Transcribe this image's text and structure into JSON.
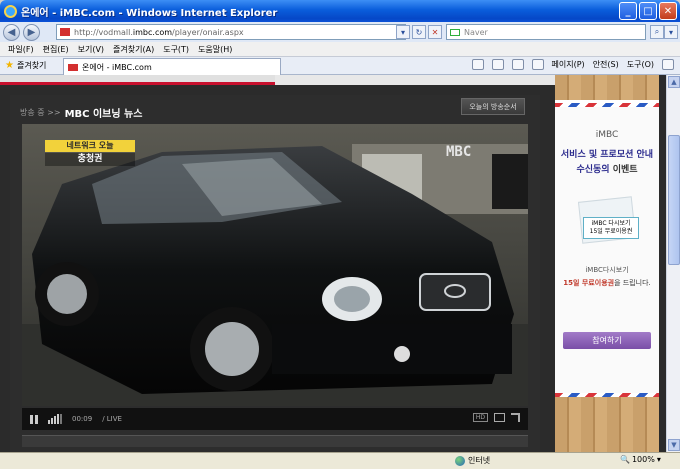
{
  "window": {
    "title": "온에어 - iMBC.com - Windows Internet Explorer"
  },
  "address": {
    "url_prefix": "http://vodmall.",
    "url_domain": "imbc.com",
    "url_suffix": "/player/onair.aspx",
    "search_placeholder": "Naver"
  },
  "menu": [
    "파일(F)",
    "편집(E)",
    "보기(V)",
    "즐겨찾기(A)",
    "도구(T)",
    "도움말(H)"
  ],
  "favbar": {
    "favorites_label": "즐겨찾기",
    "tab_title": "온에어 - iMBC.com",
    "tools": [
      "페이지(P)",
      "안전(S)",
      "도구(O)"
    ]
  },
  "player": {
    "breadcrumb_section": "방송 중 >>",
    "program_title": "MBC 이브닝 뉴스",
    "schedule_button": "오늘의 방송순서",
    "overlay_tag": "네트워크 오늘",
    "overlay_region": "충청권",
    "channel_logo": "MBC",
    "time": "00:09",
    "live_label": "/ LIVE",
    "hd_label": "HD"
  },
  "ad": {
    "brand": "iMBC",
    "headline1": "서비스 및 프로모션 안내",
    "headline2_highlight": "수신동의",
    "headline2_rest": " 이벤트",
    "coupon_line1": "iMBC 다시보기",
    "coupon_line2": "15일 무료이용권",
    "desc1": "iMBC다시보기",
    "desc2_highlight": "15일 무료이용권",
    "desc2_rest": "을 드립니다.",
    "button": "참여하기"
  },
  "status": {
    "zone": "인터넷",
    "zoom": "100%"
  }
}
